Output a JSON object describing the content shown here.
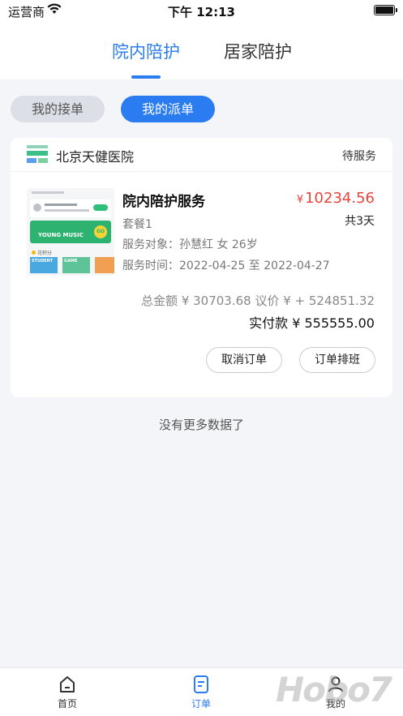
{
  "status_bar": {
    "carrier": "运营商",
    "time": "下午 12:13"
  },
  "top_tabs": {
    "items": [
      {
        "label": "院内陪护"
      },
      {
        "label": "居家陪护"
      }
    ],
    "active": 0
  },
  "filter_pills": {
    "items": [
      {
        "label": "我的接单"
      },
      {
        "label": "我的派单"
      }
    ],
    "active": 1
  },
  "order": {
    "hospital": "北京天健医院",
    "status": "待服务",
    "service_title": "院内陪护服务",
    "price_currency": "¥",
    "price": "10234.56",
    "package": "套餐1",
    "duration": "共3天",
    "target": "服务对象：孙慧红 女 26岁",
    "time": "服务时间：2022-04-25 至 2022-04-27",
    "summary_line": "总金额 ¥ 30703.68  议价 ¥ + 524851.32",
    "paid_line": "实付款 ¥ 555555.00",
    "thumbnail": {
      "banner_text": "YOUNG MUSIC",
      "go": "GO",
      "section": "花积分",
      "tile1": "STUDENT",
      "tile2": "GAME"
    },
    "actions": {
      "cancel": "取消订单",
      "arrange": "订单排班"
    }
  },
  "list_footer": "没有更多数据了",
  "bottom_nav": {
    "items": [
      {
        "label": "首页",
        "icon": "home-icon"
      },
      {
        "label": "订单",
        "icon": "order-icon"
      },
      {
        "label": "我的",
        "icon": "profile-icon"
      }
    ],
    "active": 1
  },
  "watermark": "Hobo7",
  "colors": {
    "accent": "#2a7cf0",
    "price": "#e8443c"
  }
}
